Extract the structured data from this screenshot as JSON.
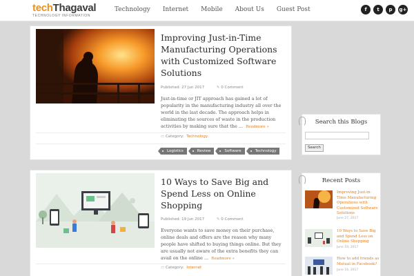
{
  "header": {
    "logo_part1": "tech",
    "logo_part2": "Thagaval",
    "tagline": "TECHNOLOGY INFORMATION",
    "nav": [
      "Technology",
      "Internet",
      "Mobile",
      "About Us",
      "Guest Post"
    ],
    "social": [
      {
        "icon": "facebook-icon",
        "glyph": "f"
      },
      {
        "icon": "twitter-icon",
        "glyph": "t"
      },
      {
        "icon": "pinterest-icon",
        "glyph": "p"
      },
      {
        "icon": "google-plus-icon",
        "glyph": "g+"
      }
    ]
  },
  "posts": [
    {
      "title": "Improving Just-in-Time Manufacturing Operations with Customized Software Solutions",
      "published": "Published: 27 Jun 2017",
      "comments": "0 Comment",
      "excerpt": "Just-in-time or JIT approach has gained a lot of popularity in the manufacturing industry all over the world in the last decade. The approach helps in eliminating the sources of waste in the production activities by making sure that the ...",
      "read_more": "Readmore »",
      "category_label": "Category:",
      "category": "Technology",
      "tags": [
        "Logistics",
        "Review",
        "Software",
        "Technology"
      ]
    },
    {
      "title": "10 Ways to Save Big and Spend Less on Online Shopping",
      "published": "Published: 19 Jun 2017",
      "comments": "0 Comment",
      "excerpt": "Everyone wants to save money on their purchase, online deals and offers are the reason why many people have shifted to buying things online. But they are usually not aware of the extra benefits they can avail on the online ...",
      "read_more": "Readmore »",
      "category_label": "Category:",
      "category": "Internet"
    }
  ],
  "sidebar": {
    "search": {
      "title": "Search this Blogs",
      "button": "Search"
    },
    "recent": {
      "title": "Recent Posts",
      "items": [
        {
          "title": "Improving Just-in-Time Manufacturing Operations with Customized Software Solutions",
          "date": "June 27, 2017"
        },
        {
          "title": "10 Ways to Save Big and Spend Less on Online Shopping",
          "date": "June 19, 2017"
        },
        {
          "title": "How to add friends as Mutual in Facebook?",
          "date": "June 16, 2017"
        }
      ]
    }
  },
  "colors": {
    "accent": "#e57d15",
    "logo_orange": "#ef8f1a",
    "background": "#d9d9d9"
  }
}
